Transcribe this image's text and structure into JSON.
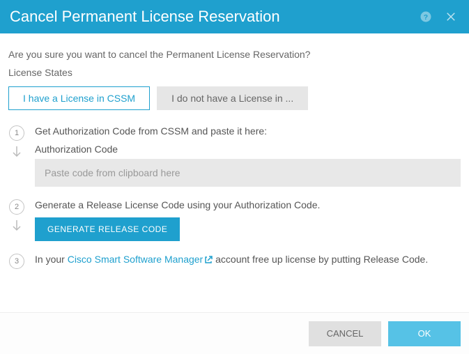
{
  "header": {
    "title": "Cancel Permanent License Reservation"
  },
  "confirm_text": "Are you sure you want to cancel the Permanent License Reservation?",
  "section_label": "License States",
  "tabs": {
    "active": "I have a License in CSSM",
    "inactive": "I do not have a License in ..."
  },
  "steps": {
    "s1": {
      "num": "1",
      "instruction": "Get Authorization Code from CSSM and paste it here:",
      "field_label": "Authorization Code",
      "placeholder": "Paste code from clipboard here"
    },
    "s2": {
      "num": "2",
      "instruction": "Generate a Release License Code using your Authorization Code.",
      "button": "GENERATE RELEASE CODE"
    },
    "s3": {
      "num": "3",
      "prefix": "In your ",
      "link": "Cisco Smart Software Manager",
      "suffix": " account free up license by putting Release Code."
    }
  },
  "footer": {
    "cancel": "CANCEL",
    "ok": "OK"
  }
}
